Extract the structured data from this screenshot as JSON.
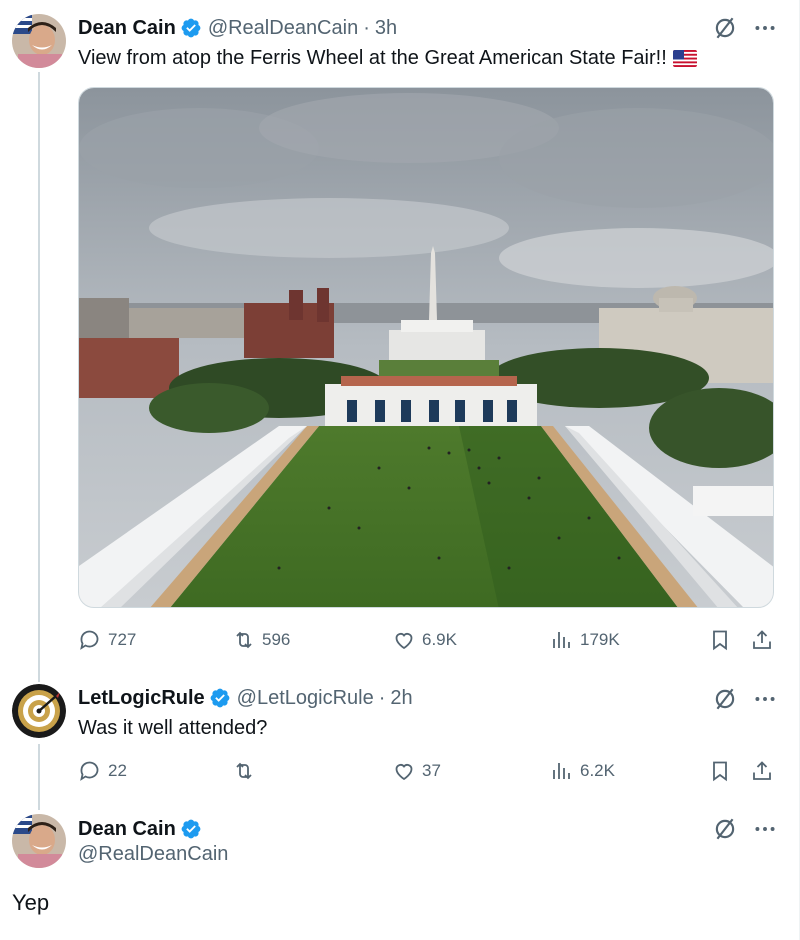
{
  "posts": [
    {
      "author_name": "Dean Cain",
      "handle": "@RealDeanCain",
      "time": "3h",
      "text": "View from atop the Ferris Wheel at the Great American State Fair!!",
      "flag_emoji": "🇺🇸",
      "stats": {
        "replies": "727",
        "reposts": "596",
        "likes": "6.9K",
        "views": "179K"
      }
    },
    {
      "author_name": "LetLogicRule",
      "handle": "@LetLogicRule",
      "time": "2h",
      "text": "Was it well attended?",
      "stats": {
        "replies": "22",
        "reposts": "",
        "likes": "37",
        "views": "6.2K"
      }
    },
    {
      "author_name": "Dean Cain",
      "handle": "@RealDeanCain",
      "text": "Yep"
    }
  ],
  "icons": {
    "verified": "verified-badge-icon",
    "grok": "grok-icon",
    "more": "more-icon",
    "reply": "reply-icon",
    "repost": "repost-icon",
    "like": "heart-icon",
    "views": "views-icon",
    "bookmark": "bookmark-icon",
    "share": "share-icon"
  },
  "colors": {
    "text": "#0f1419",
    "secondary": "#536471",
    "verified": "#1d9bf0",
    "border": "#cfd9de"
  }
}
